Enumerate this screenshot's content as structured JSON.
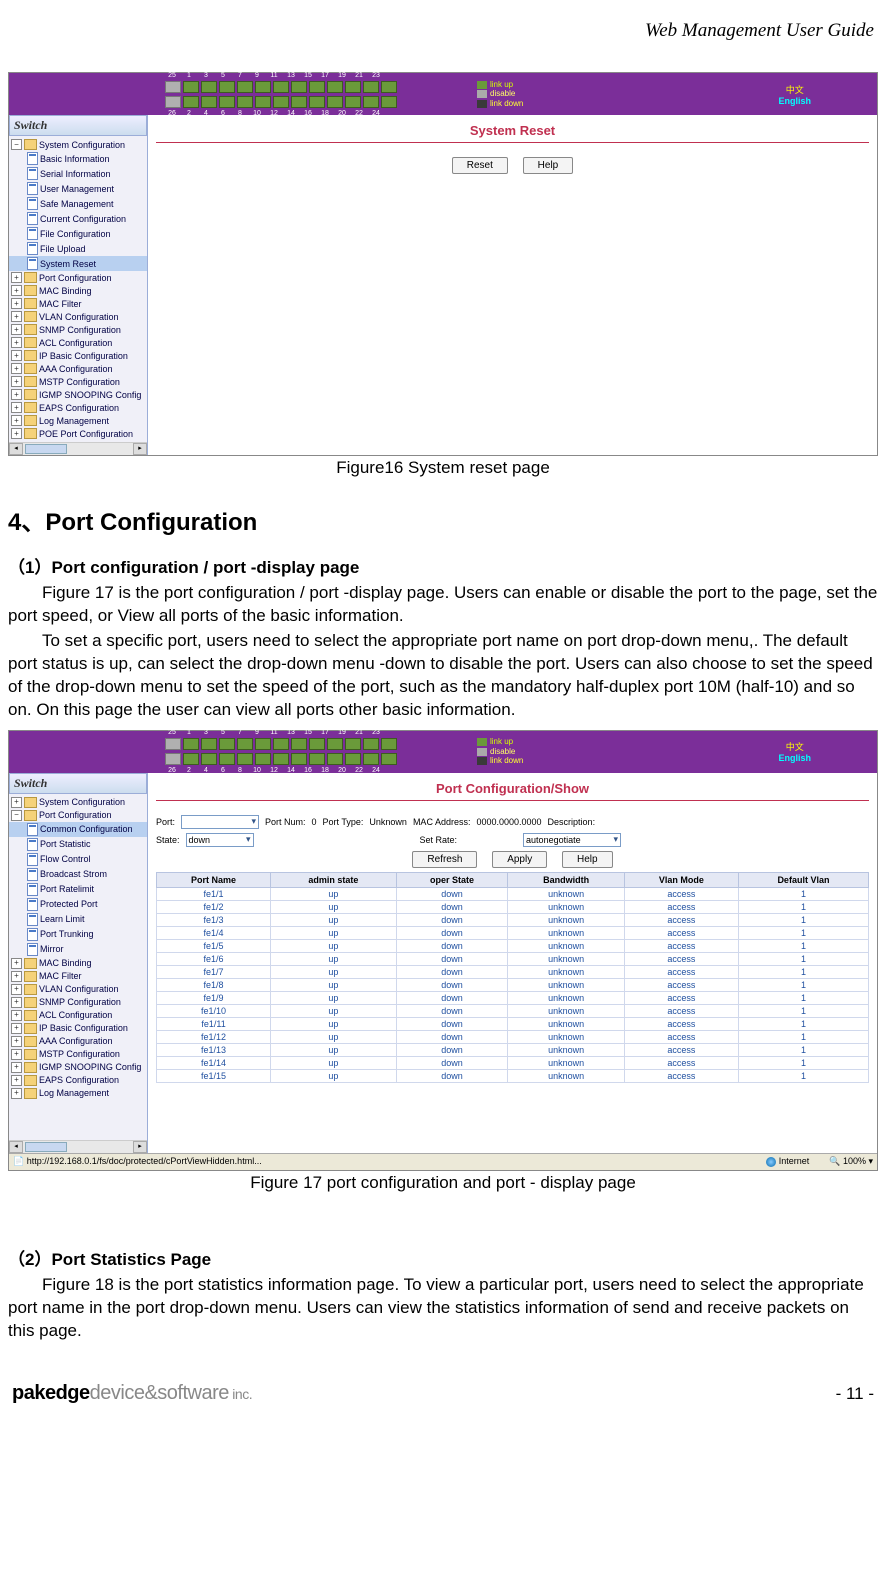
{
  "header": {
    "title": "Web Management User Guide"
  },
  "fig1": {
    "topbar_ports_top": [
      "25",
      "1",
      "3",
      "5",
      "7",
      "9",
      "11",
      "13",
      "15",
      "17",
      "19",
      "21",
      "23"
    ],
    "topbar_ports_bot": [
      "26",
      "2",
      "4",
      "6",
      "8",
      "10",
      "12",
      "14",
      "16",
      "18",
      "20",
      "22",
      "24"
    ],
    "legend": {
      "up": "link up",
      "dis": "disable",
      "down": "link down"
    },
    "lang": {
      "cn": "中文",
      "en": "English"
    },
    "sidebar_title": "Switch",
    "tree_sysconf": "System Configuration",
    "tree_sub": [
      "Basic Information",
      "Serial Information",
      "User Management",
      "Safe Management",
      "Current Configuration",
      "File Configuration",
      "File Upload",
      "System Reset"
    ],
    "tree_folders": [
      "Port Configuration",
      "MAC Binding",
      "MAC Filter",
      "VLAN Configuration",
      "SNMP Configuration",
      "ACL Configuration",
      "IP Basic Configuration",
      "AAA Configuration",
      "MSTP Configuration",
      "IGMP SNOOPING Config",
      "EAPS Configuration",
      "Log Management",
      "POE Port Configuration"
    ],
    "panel_title": "System Reset",
    "btn_reset": "Reset",
    "btn_help": "Help"
  },
  "cap1": "Figure16 System reset page",
  "section_num": "4、",
  "section_title": "Port Configuration",
  "sub1_num": "（1）",
  "sub1_title": "Port configuration / port -display page",
  "para1": "Figure 17 is the port configuration / port -display page. Users can enable or disable the port to the page, set the port speed, or View all ports of the basic information.",
  "para2": "To set a specific port, users need to select the appropriate port name on port drop-down menu,. The default port status is up, can select the drop-down menu -down to disable the port. Users can also choose to set the speed of the drop-down menu to set the speed of the port, such as the mandatory half-duplex port 10M (half-10) and so on. On this page the user can view all ports other basic information.",
  "fig2": {
    "sidebar_title": "Switch",
    "tree_sysconf": "System Configuration",
    "tree_portconf": "Port Configuration",
    "tree_sub": [
      "Common Configuration",
      "Port Statistic",
      "Flow Control",
      "Broadcast Strom",
      "Port Ratelimit",
      "Protected Port",
      "Learn Limit",
      "Port Trunking",
      "Mirror"
    ],
    "tree_folders": [
      "MAC Binding",
      "MAC Filter",
      "VLAN Configuration",
      "SNMP Configuration",
      "ACL Configuration",
      "IP Basic Configuration",
      "AAA Configuration",
      "MSTP Configuration",
      "IGMP SNOOPING Config",
      "EAPS Configuration",
      "Log Management"
    ],
    "panel_title": "Port Configuration/Show",
    "lbl_port": "Port:",
    "lbl_portnum": "Port Num:",
    "val_portnum": "0",
    "lbl_porttype": "Port Type:",
    "val_porttype": "Unknown",
    "lbl_mac": "MAC Address:",
    "val_mac": "0000.0000.0000",
    "lbl_desc": "Description:",
    "lbl_state": "State:",
    "val_state": "down",
    "lbl_rate": "Set Rate:",
    "val_rate": "autonegotiate",
    "btn_refresh": "Refresh",
    "btn_apply": "Apply",
    "btn_help": "Help",
    "thead": [
      "Port Name",
      "admin state",
      "oper State",
      "Bandwidth",
      "Vlan Mode",
      "Default Vlan"
    ],
    "rows": [
      [
        "fe1/1",
        "up",
        "down",
        "unknown",
        "access",
        "1"
      ],
      [
        "fe1/2",
        "up",
        "down",
        "unknown",
        "access",
        "1"
      ],
      [
        "fe1/3",
        "up",
        "down",
        "unknown",
        "access",
        "1"
      ],
      [
        "fe1/4",
        "up",
        "down",
        "unknown",
        "access",
        "1"
      ],
      [
        "fe1/5",
        "up",
        "down",
        "unknown",
        "access",
        "1"
      ],
      [
        "fe1/6",
        "up",
        "down",
        "unknown",
        "access",
        "1"
      ],
      [
        "fe1/7",
        "up",
        "down",
        "unknown",
        "access",
        "1"
      ],
      [
        "fe1/8",
        "up",
        "down",
        "unknown",
        "access",
        "1"
      ],
      [
        "fe1/9",
        "up",
        "down",
        "unknown",
        "access",
        "1"
      ],
      [
        "fe1/10",
        "up",
        "down",
        "unknown",
        "access",
        "1"
      ],
      [
        "fe1/11",
        "up",
        "down",
        "unknown",
        "access",
        "1"
      ],
      [
        "fe1/12",
        "up",
        "down",
        "unknown",
        "access",
        "1"
      ],
      [
        "fe1/13",
        "up",
        "down",
        "unknown",
        "access",
        "1"
      ],
      [
        "fe1/14",
        "up",
        "down",
        "unknown",
        "access",
        "1"
      ],
      [
        "fe1/15",
        "up",
        "down",
        "unknown",
        "access",
        "1"
      ]
    ],
    "status_url": "http://192.168.0.1/fs/doc/protected/cPortViewHidden.html...",
    "status_zone": "Internet",
    "status_zoom": "100%"
  },
  "cap2": "Figure 17 port configuration and port - display page",
  "sub2_num": "（2）",
  "sub2_title": "Port Statistics Page",
  "para3": "Figure 18 is the port statistics information page. To view a particular port, users need to select the appropriate port name in the port drop-down menu. Users can view  the statistics information of send and receive packets on this page.",
  "footer": {
    "brand1": "pakedge",
    "brand2": "device&software",
    "brand3": " inc.",
    "page": "- 11 -"
  }
}
